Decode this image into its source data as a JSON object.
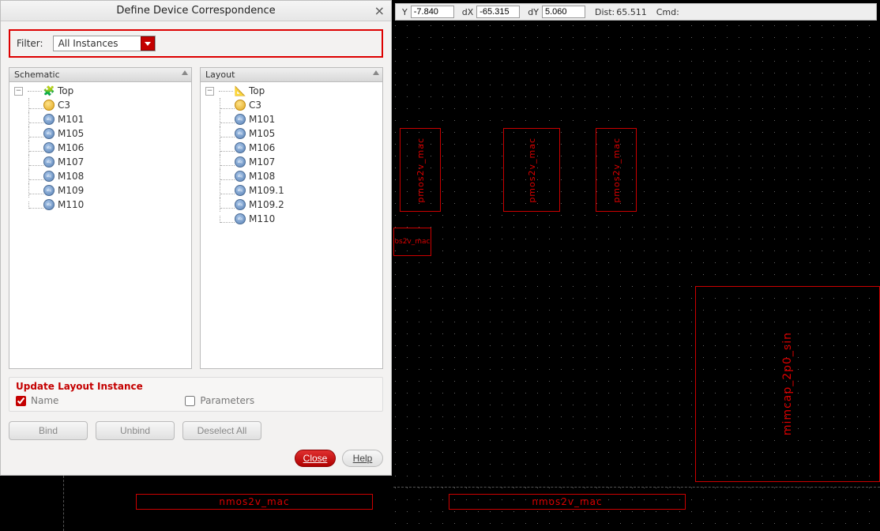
{
  "dialog": {
    "title": "Define Device Correspondence",
    "filter_label": "Filter:",
    "filter_value": "All Instances",
    "schematic_header": "Schematic",
    "layout_header": "Layout",
    "update_title": "Update Layout Instance",
    "opt_name": "Name",
    "opt_params": "Parameters",
    "btn_bind": "Bind",
    "btn_unbind": "Unbind",
    "btn_deselect": "Deselect All",
    "btn_close": "Close",
    "btn_help": "Help"
  },
  "schematic_tree": {
    "root": "Top",
    "children": [
      "C3",
      "M101",
      "M105",
      "M106",
      "M107",
      "M108",
      "M109",
      "M110"
    ]
  },
  "layout_tree": {
    "root": "Top",
    "children": [
      "C3",
      "M101",
      "M105",
      "M106",
      "M107",
      "M108",
      "M109.1",
      "M109.2",
      "M110"
    ]
  },
  "coord": {
    "y_lbl": "Y",
    "y_val": "-7.840",
    "dx_lbl": "dX",
    "dx_val": "-65.315",
    "dy_lbl": "dY",
    "dy_val": "5.060",
    "dist_lbl": "Dist:",
    "dist_val": "65.511",
    "cmd_lbl": "Cmd:"
  },
  "devices": {
    "pmos1": "pmos2v_mac",
    "pmos2": "pmos2v_mac",
    "pmos3": "pmos2v_mac",
    "small1": "os2v_mac",
    "big": "mimcap_2p0_sin",
    "nmos_a": "nmos2v_mac",
    "nmos_b": "nmos2v_mac"
  }
}
